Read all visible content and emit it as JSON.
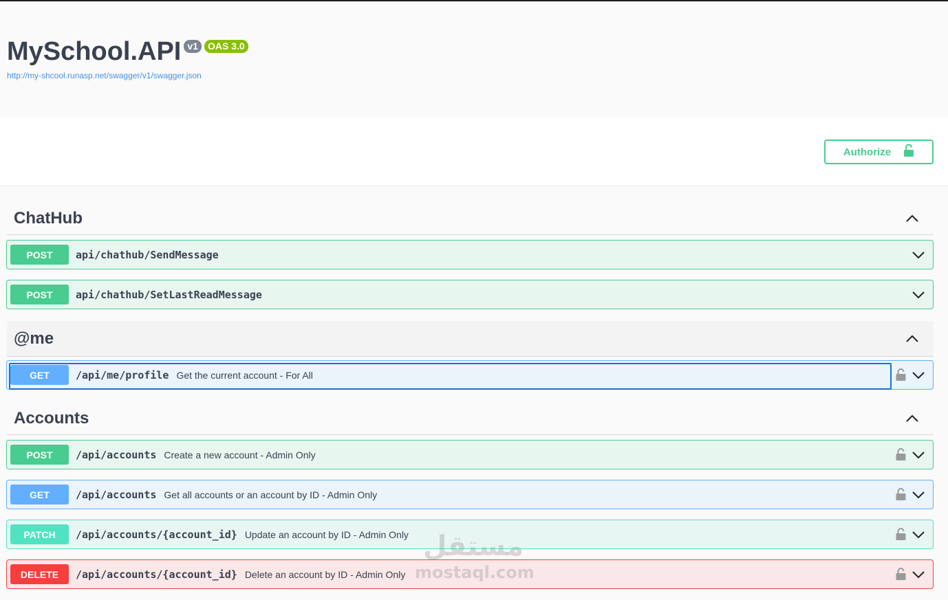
{
  "info": {
    "title": "MySchool.API",
    "version_badge": "v1",
    "oas_badge": "OAS 3.0",
    "spec_url": "http://my-shcool.runasp.net/swagger/v1/swagger.json"
  },
  "authorize": {
    "label": "Authorize"
  },
  "tags": {
    "chathub": {
      "name": "ChatHub",
      "ops": [
        {
          "method": "POST",
          "path": "api/chathub/SendMessage",
          "summary": ""
        },
        {
          "method": "POST",
          "path": "api/chathub/SetLastReadMessage",
          "summary": ""
        }
      ]
    },
    "me": {
      "name": "@me",
      "ops": [
        {
          "method": "GET",
          "path": "/api/me/profile",
          "summary": "Get the current account - For All"
        }
      ]
    },
    "accounts": {
      "name": "Accounts",
      "ops": [
        {
          "method": "POST",
          "path": "/api/accounts",
          "summary": "Create a new account - Admin Only"
        },
        {
          "method": "GET",
          "path": "/api/accounts",
          "summary": "Get all accounts or an account by ID - Admin Only"
        },
        {
          "method": "PATCH",
          "path": "/api/accounts/{account_id}",
          "summary": "Update an account by ID - Admin Only"
        },
        {
          "method": "DELETE",
          "path": "/api/accounts/{account_id}",
          "summary": "Delete an account by ID - Admin Only"
        }
      ]
    }
  },
  "watermark": {
    "arabic": "مستقل",
    "latin": "mostaql.com"
  },
  "colors": {
    "post": "#49cc90",
    "get": "#61affe",
    "patch": "#50e3c2",
    "delete": "#f93e3e",
    "link": "#4990e2",
    "text": "#3b4151"
  }
}
